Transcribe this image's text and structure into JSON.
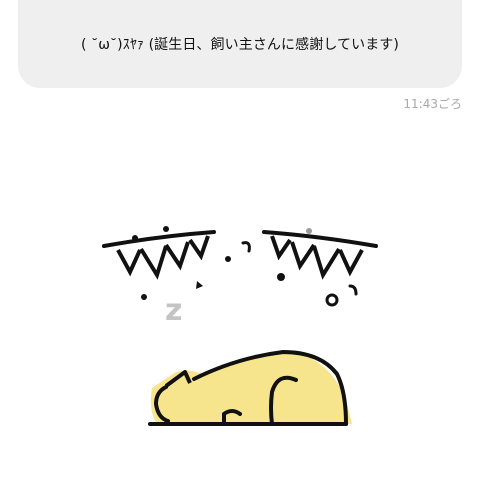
{
  "message": {
    "text": "( ˘ω˘)ｽﾔｧ (誕生日、飼い主さんに感謝しています)",
    "time": "11:43ごろ"
  },
  "sticker": {
    "icon": "sleeping-cat-sticker",
    "zzz": "z"
  },
  "colors": {
    "bubble": "#efefef",
    "text": "#111111",
    "timestamp": "#a9a9a9",
    "ink": "#111111",
    "cat_fill": "#f6e58d",
    "z_gray": "#c4c4c4",
    "accent_gray": "#9a9a9a"
  }
}
